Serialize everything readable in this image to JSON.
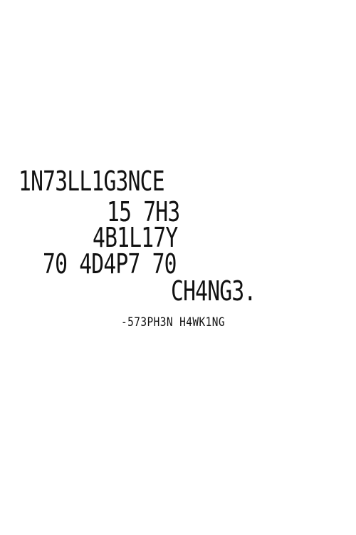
{
  "quote": {
    "lines": [
      "1N73LL1G3NCE",
      "15 7H3",
      "4B1L17Y",
      "70 4D4P7 70",
      "CH4NG3."
    ],
    "attribution": "-573PH3N H4WK1NG"
  },
  "colors": {
    "background": "#ffffff",
    "text": "#111111"
  }
}
